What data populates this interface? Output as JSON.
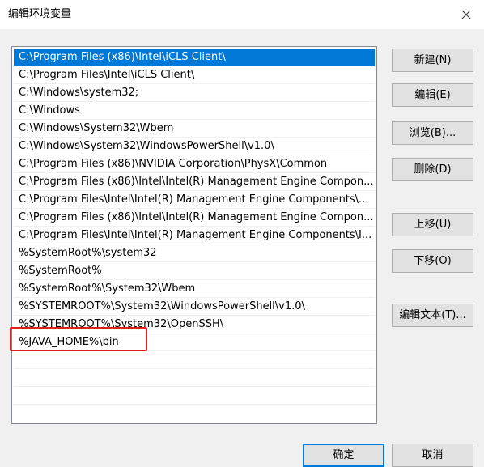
{
  "dialog": {
    "title": "编辑环境变量",
    "close_icon": "close-icon"
  },
  "path_list": {
    "selected_index": 0,
    "highlighted_index": 17,
    "items": [
      "C:\\Program Files (x86)\\Intel\\iCLS Client\\",
      "C:\\Program Files\\Intel\\iCLS Client\\",
      "C:\\Windows\\system32;",
      "C:\\Windows",
      "C:\\Windows\\System32\\Wbem",
      "C:\\Windows\\System32\\WindowsPowerShell\\v1.0\\",
      "C:\\Program Files (x86)\\NVIDIA Corporation\\PhysX\\Common",
      "C:\\Program Files (x86)\\Intel\\Intel(R) Management Engine Compon...",
      "C:\\Program Files\\Intel\\Intel(R) Management Engine Components\\...",
      "C:\\Program Files (x86)\\Intel\\Intel(R) Management Engine Compon...",
      "C:\\Program Files\\Intel\\Intel(R) Management Engine Components\\I...",
      "%SystemRoot%\\system32",
      "%SystemRoot%",
      "%SystemRoot%\\System32\\Wbem",
      "%SYSTEMROOT%\\System32\\WindowsPowerShell\\v1.0\\",
      "%SYSTEMROOT%\\System32\\OpenSSH\\",
      "%JAVA_HOME%\\bin",
      "",
      "",
      "",
      ""
    ]
  },
  "buttons": {
    "new_label": "新建(N)",
    "edit_label": "编辑(E)",
    "browse_label": "浏览(B)...",
    "delete_label": "删除(D)",
    "move_up_label": "上移(U)",
    "move_down_label": "下移(O)",
    "edit_text_label": "编辑文本(T)...",
    "ok_label": "确定",
    "cancel_label": "取消"
  },
  "colors": {
    "selection": "#0078d7",
    "highlight_annotation": "#e0201c",
    "dialog_background": "#f0f0f0"
  }
}
